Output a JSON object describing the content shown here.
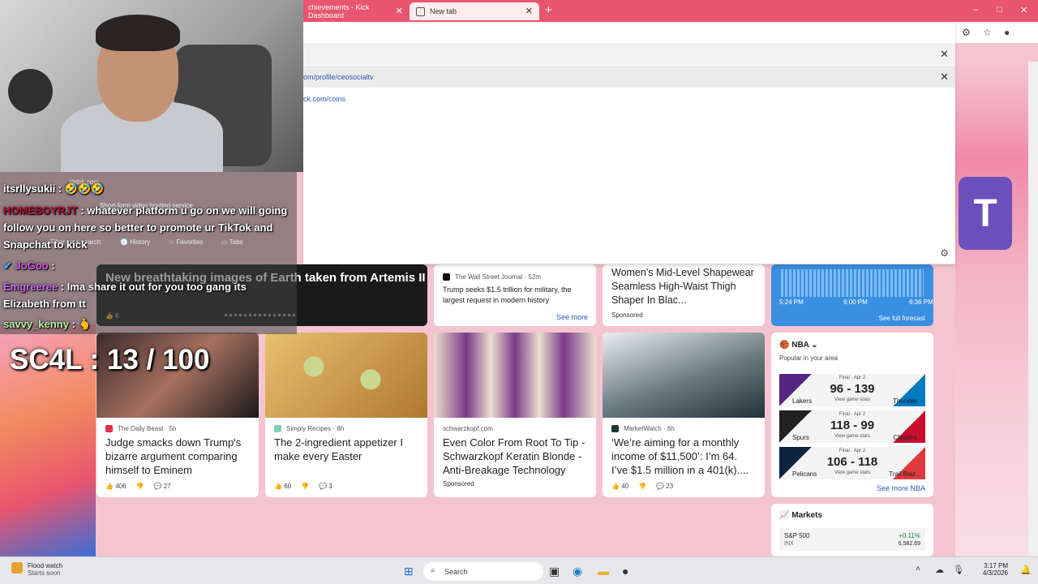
{
  "browser": {
    "tabs": [
      {
        "label": "chievements - Kick Dashboard"
      },
      {
        "label": "New tab"
      }
    ],
    "new_tab_symbol": "+",
    "window_controls": [
      "–",
      "□",
      "✕"
    ]
  },
  "dropdown": {
    "rows": [
      {
        "text": ""
      },
      {
        "text": "om/profile/ceosocialtv"
      },
      {
        "text": "ck.com/coins"
      }
    ],
    "filter_placeholder": "Filter your search:",
    "filters": [
      "History",
      "Favorites",
      "Tabs"
    ],
    "tiktok_label": "tiktok.com",
    "tiktok_desc": "Short-form video hosting service"
  },
  "chat": {
    "messages": [
      {
        "user": "itsrllysukii",
        "sep": " : ",
        "text": "🤣🤣🤣"
      },
      {
        "user": "HOMEBOYRJT",
        "sep": " : ",
        "text": "whatever platform u go on we will going"
      },
      {
        "user": "",
        "sep": "",
        "text": "follow you on here so better to promote ur TikTok and"
      },
      {
        "user": "",
        "sep": "",
        "text": "Snapchat to kick"
      },
      {
        "user": "JoGoo",
        "sep": " : ",
        "text": ""
      },
      {
        "user": "Emgreeree",
        "sep": " : ",
        "text": "Ima share it out for you too gang its"
      },
      {
        "user": "",
        "sep": "",
        "text": "Elizabeth from tt"
      },
      {
        "user": "savvy_kenny",
        "sep": " : ",
        "text": "🫰"
      }
    ]
  },
  "overlay": {
    "counter": "SC4L : 13 / 100"
  },
  "feed": {
    "hero": {
      "title": "New breathtaking images of Earth taken from Artemis II",
      "likes": "6"
    },
    "wsj": {
      "source": "The Wall Street Journal · 52m",
      "headline": "Trump seeks $1.5 trillion for military, the largest request in modern history",
      "see_more": "See more"
    },
    "women": {
      "headline": "Women's Mid-Level Shapewear Seamless High-Waist Thigh Shaper In Blac...",
      "sponsored": "Sponsored"
    },
    "weather": {
      "times": [
        "5:24 PM",
        "6:00 PM",
        "6:36 PM"
      ],
      "forecast": "See full forecast"
    },
    "cards": [
      {
        "source": "The Daily Beast · 5h",
        "headline": "Judge smacks down Trump's bizarre argument comparing himself to Eminem",
        "likes": "406",
        "comments": "27"
      },
      {
        "source": "Simply Recipes · 8h",
        "headline": "The 2-ingredient appetizer I make every Easter",
        "likes": "60",
        "comments": "3"
      },
      {
        "source": "schwarzkopf.com",
        "headline": "Even Color From Root To Tip - Schwarzkopf Keratin Blonde - Anti-Breakage Technology",
        "sponsored": "Sponsored"
      },
      {
        "source": "MarketWatch · 6h",
        "headline": "‘We’re aiming for a monthly income of $11,500’: I’m 64. I’ve $1.5 million in a 401(k)....",
        "likes": "40",
        "comments": "23"
      }
    ]
  },
  "nba": {
    "title": "NBA",
    "popular": "Popular in your area",
    "games": [
      {
        "final": "Final · Apr 2",
        "score": "96 - 139",
        "team1": "Lakers",
        "team2": "Thunder",
        "stats": "View game stats"
      },
      {
        "final": "Final · Apr 2",
        "score": "118 - 99",
        "team1": "Spurs",
        "team2": "Clippers",
        "stats": "View game stats"
      },
      {
        "final": "Final · Apr 2",
        "score": "106 - 118",
        "team1": "Pelicans",
        "team2": "Trail Blaz...",
        "stats": "View game stats"
      }
    ],
    "more": "See more NBA",
    "colors": {
      "lakers": "#552583",
      "thunder": "#007ac1",
      "spurs": "#222222",
      "clippers": "#c8102e",
      "pelicans": "#0c2340",
      "blazers": "#e03a3e"
    }
  },
  "markets": {
    "title": "Markets",
    "symbol": "S&P 500",
    "sub": "INX",
    "change": "+0.11%",
    "value": "6,582.69"
  },
  "taskbar": {
    "weather_title": "Flood watch",
    "weather_sub": "Starts soon",
    "search": "Search",
    "time": "3:17 PM",
    "date": "4/3/2026"
  }
}
